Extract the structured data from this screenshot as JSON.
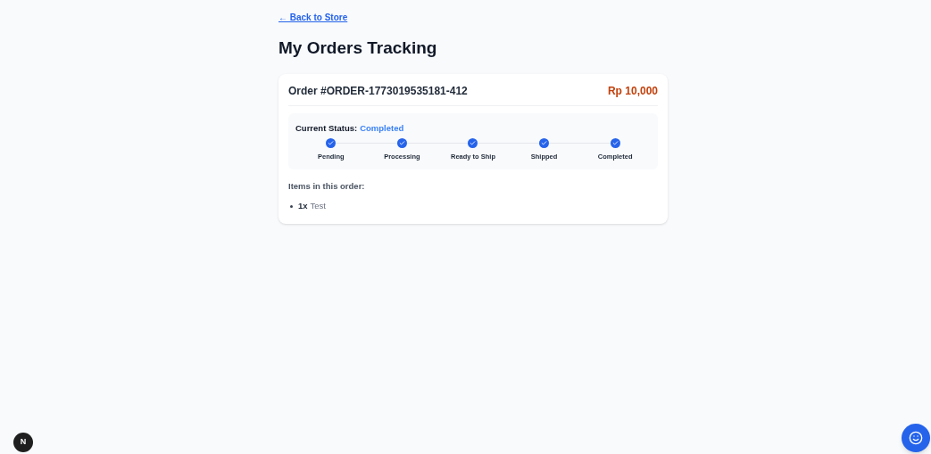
{
  "back_link": "← Back to Store",
  "title": "My Orders Tracking",
  "order": {
    "number": "Order #ORDER-1773019535181-412",
    "total": "Rp 10,000",
    "status_label": "Current Status:",
    "status_value": "Completed",
    "steps": [
      {
        "label": "Pending",
        "done": true
      },
      {
        "label": "Processing",
        "done": true
      },
      {
        "label": "Ready to Ship",
        "done": true
      },
      {
        "label": "Shipped",
        "done": true
      },
      {
        "label": "Completed",
        "done": true
      }
    ],
    "items_heading": "Items in this order:",
    "items": [
      {
        "qty": "1x",
        "name": "Test"
      }
    ]
  },
  "dev_badge": "N"
}
